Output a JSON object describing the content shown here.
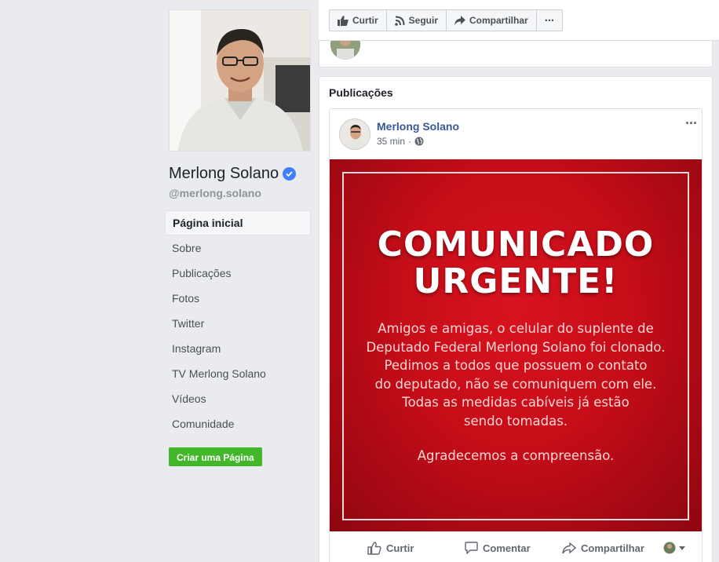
{
  "page": {
    "name": "Merlong Solano",
    "handle": "@merlong.solano"
  },
  "nav": {
    "items": [
      {
        "label": "Página inicial",
        "active": true
      },
      {
        "label": "Sobre"
      },
      {
        "label": "Publicações"
      },
      {
        "label": "Fotos"
      },
      {
        "label": "Twitter"
      },
      {
        "label": "Instagram"
      },
      {
        "label": "TV Merlong Solano"
      },
      {
        "label": "Vídeos"
      },
      {
        "label": "Comunidade"
      }
    ],
    "create_page": "Criar uma Página"
  },
  "action_bar": {
    "like": "Curtir",
    "follow": "Seguir",
    "share": "Compartilhar",
    "more": "···"
  },
  "publications": {
    "title": "Publicações",
    "post": {
      "author": "Merlong Solano",
      "time": "35 min",
      "separator": "·",
      "more": "···",
      "image": {
        "heading_line1": "COMUNICADO",
        "heading_line2": "URGENTE!",
        "body_lines": [
          "Amigos e amigas, o celular do suplente de",
          "Deputado Federal Merlong Solano foi clonado.",
          "Pedimos a todos que possuem o contato",
          "do deputado, não se comuniquem com ele.",
          "Todas as medidas cabíveis já estão",
          "sendo tomadas."
        ],
        "closing": "Agradecemos a compreensão."
      },
      "actions": {
        "like": "Curtir",
        "comment": "Comentar",
        "share": "Compartilhar"
      }
    }
  },
  "colors": {
    "link": "#365899",
    "verified": "#4080ff",
    "create_button": "#42b72a",
    "image_red": "#c50d18"
  }
}
